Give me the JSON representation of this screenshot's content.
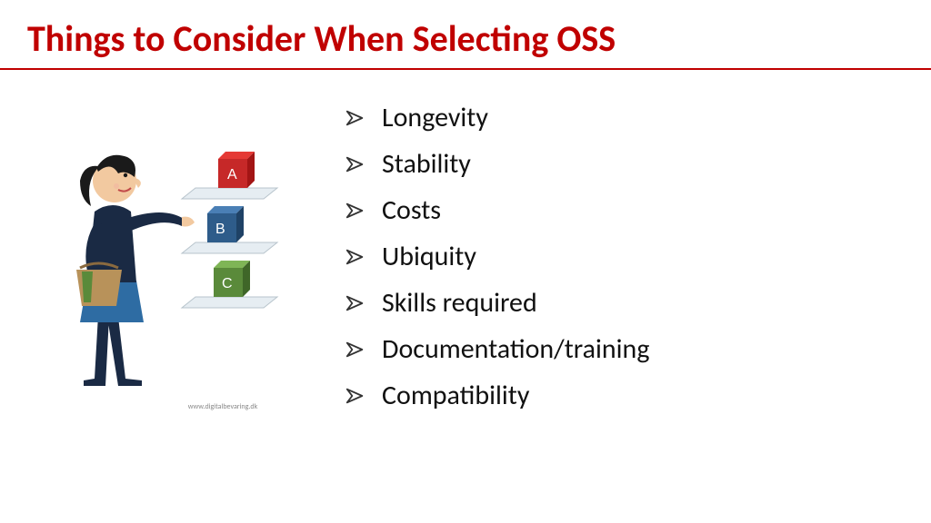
{
  "title": "Things to Consider When Selecting OSS",
  "bullets": [
    "Longevity",
    "Stability",
    "Costs",
    "Ubiquity",
    "Skills required",
    "Documentation/training",
    "Compatibility"
  ],
  "illustration": {
    "credit": "www.digitalbevaring.dk",
    "block_labels": [
      "A",
      "B",
      "C"
    ]
  }
}
